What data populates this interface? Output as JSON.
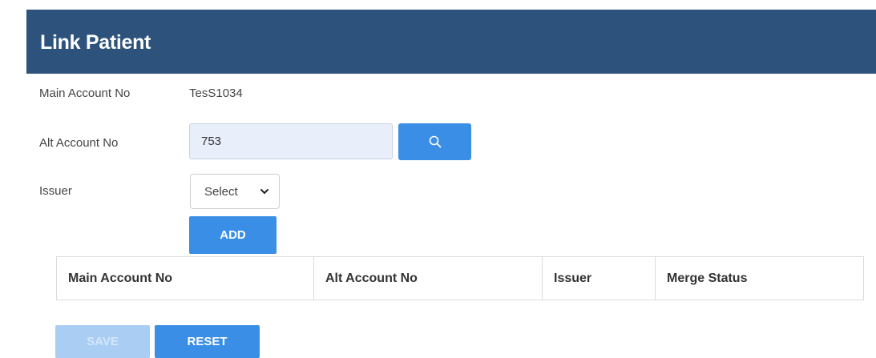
{
  "header": {
    "title": "Link Patient"
  },
  "form": {
    "main_account_label": "Main Account No",
    "main_account_value": "TesS1034",
    "alt_account_label": "Alt Account No",
    "alt_account_value": "753",
    "issuer_label": "Issuer",
    "issuer_selected": "Select",
    "add_label": "ADD"
  },
  "icons": {
    "search": "search-icon",
    "chevron": "chevron-down-icon"
  },
  "table": {
    "columns": [
      "Main Account No",
      "Alt Account No",
      "Issuer",
      "Merge Status"
    ]
  },
  "actions": {
    "save_label": "SAVE",
    "reset_label": "RESET"
  },
  "colors": {
    "header_bg": "#2d527c",
    "primary": "#3a8ee6",
    "disabled": "#a9cdf3",
    "input_bg": "#e8eefa"
  }
}
